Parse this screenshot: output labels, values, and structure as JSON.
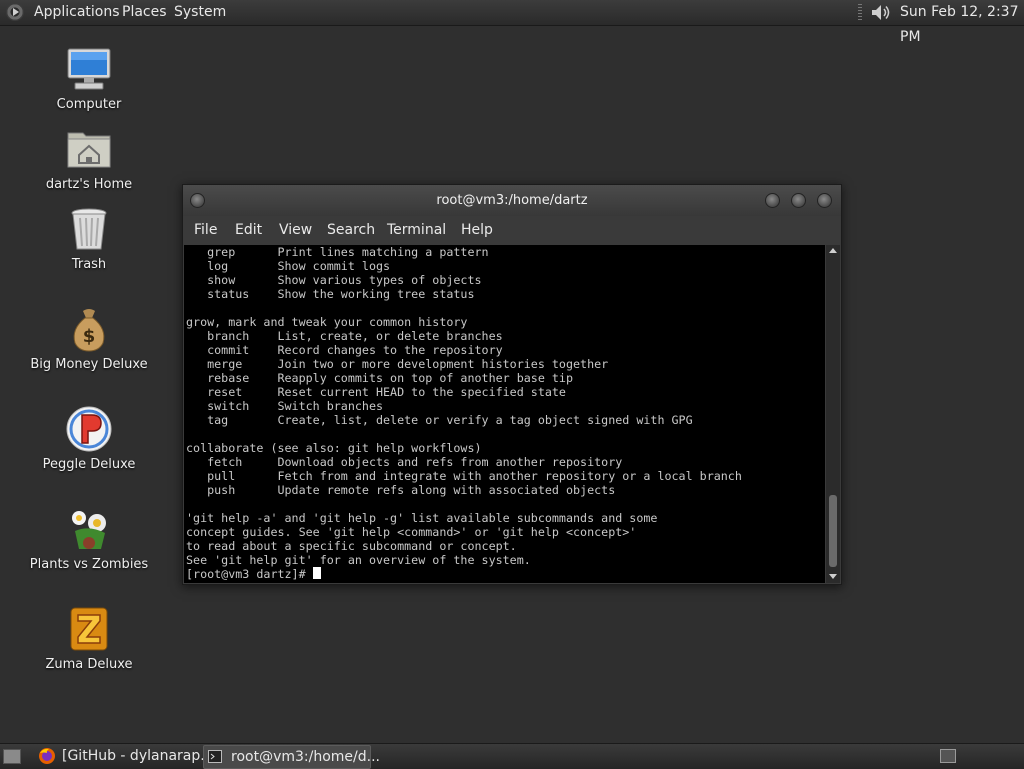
{
  "top_panel": {
    "menus": [
      "Applications",
      "Places",
      "System"
    ],
    "clock": "Sun Feb 12,  2:37 PM",
    "icons": {
      "apps": "gnome-foot-icon",
      "volume": "volume-icon"
    }
  },
  "desktop": {
    "icons": [
      {
        "label": "Computer",
        "icon": "computer-icon"
      },
      {
        "label": "dartz's Home",
        "icon": "home-folder-icon"
      },
      {
        "label": "Trash",
        "icon": "trash-icon"
      },
      {
        "label": "Big Money Deluxe",
        "icon": "money-bag-icon"
      },
      {
        "label": "Peggle Deluxe",
        "icon": "peggle-icon"
      },
      {
        "label": "Plants vs Zombies",
        "icon": "plants-zombies-icon"
      },
      {
        "label": "Zuma Deluxe",
        "icon": "zuma-icon"
      }
    ]
  },
  "window": {
    "title": "root@vm3:/home/dartz",
    "menus": [
      "File",
      "Edit",
      "View",
      "Search",
      "Terminal",
      "Help"
    ],
    "terminal_lines": [
      "   grep      Print lines matching a pattern",
      "   log       Show commit logs",
      "   show      Show various types of objects",
      "   status    Show the working tree status",
      "",
      "grow, mark and tweak your common history",
      "   branch    List, create, or delete branches",
      "   commit    Record changes to the repository",
      "   merge     Join two or more development histories together",
      "   rebase    Reapply commits on top of another base tip",
      "   reset     Reset current HEAD to the specified state",
      "   switch    Switch branches",
      "   tag       Create, list, delete or verify a tag object signed with GPG",
      "",
      "collaborate (see also: git help workflows)",
      "   fetch     Download objects and refs from another repository",
      "   pull      Fetch from and integrate with another repository or a local branch",
      "   push      Update remote refs along with associated objects",
      "",
      "'git help -a' and 'git help -g' list available subcommands and some",
      "concept guides. See 'git help <command>' or 'git help <concept>'",
      "to read about a specific subcommand or concept.",
      "See 'git help git' for an overview of the system."
    ],
    "prompt": "[root@vm3 dartz]# "
  },
  "taskbar": {
    "tasks": [
      {
        "label": "[GitHub - dylanarap...",
        "icon": "firefox-icon",
        "active": false
      },
      {
        "label": "root@vm3:/home/d...",
        "icon": "terminal-icon",
        "active": true
      }
    ]
  }
}
